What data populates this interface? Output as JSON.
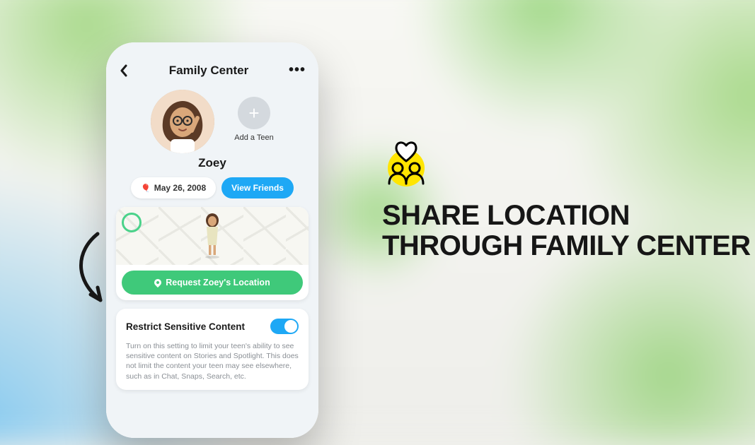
{
  "header": {
    "title": "Family Center"
  },
  "profile": {
    "name": "Zoey",
    "birthday": "May 26, 2008",
    "view_friends_label": "View Friends",
    "add_teen_label": "Add a Teen"
  },
  "location": {
    "request_button_label": "Request Zoey's Location"
  },
  "restrict": {
    "title": "Restrict Sensitive Content",
    "description": "Turn on this setting to limit your teen's ability to see sensitive content on Stories and Spotlight. This does not limit the content your teen may see elsewhere, such as in Chat, Snaps, Search, etc.",
    "toggle_on": true
  },
  "promo": {
    "headline_line1": "Share Location",
    "headline_line2": "Through Family Center"
  },
  "colors": {
    "accent_blue": "#1ea8f5",
    "accent_green": "#3fc97a",
    "brand_yellow": "#ffe500"
  }
}
